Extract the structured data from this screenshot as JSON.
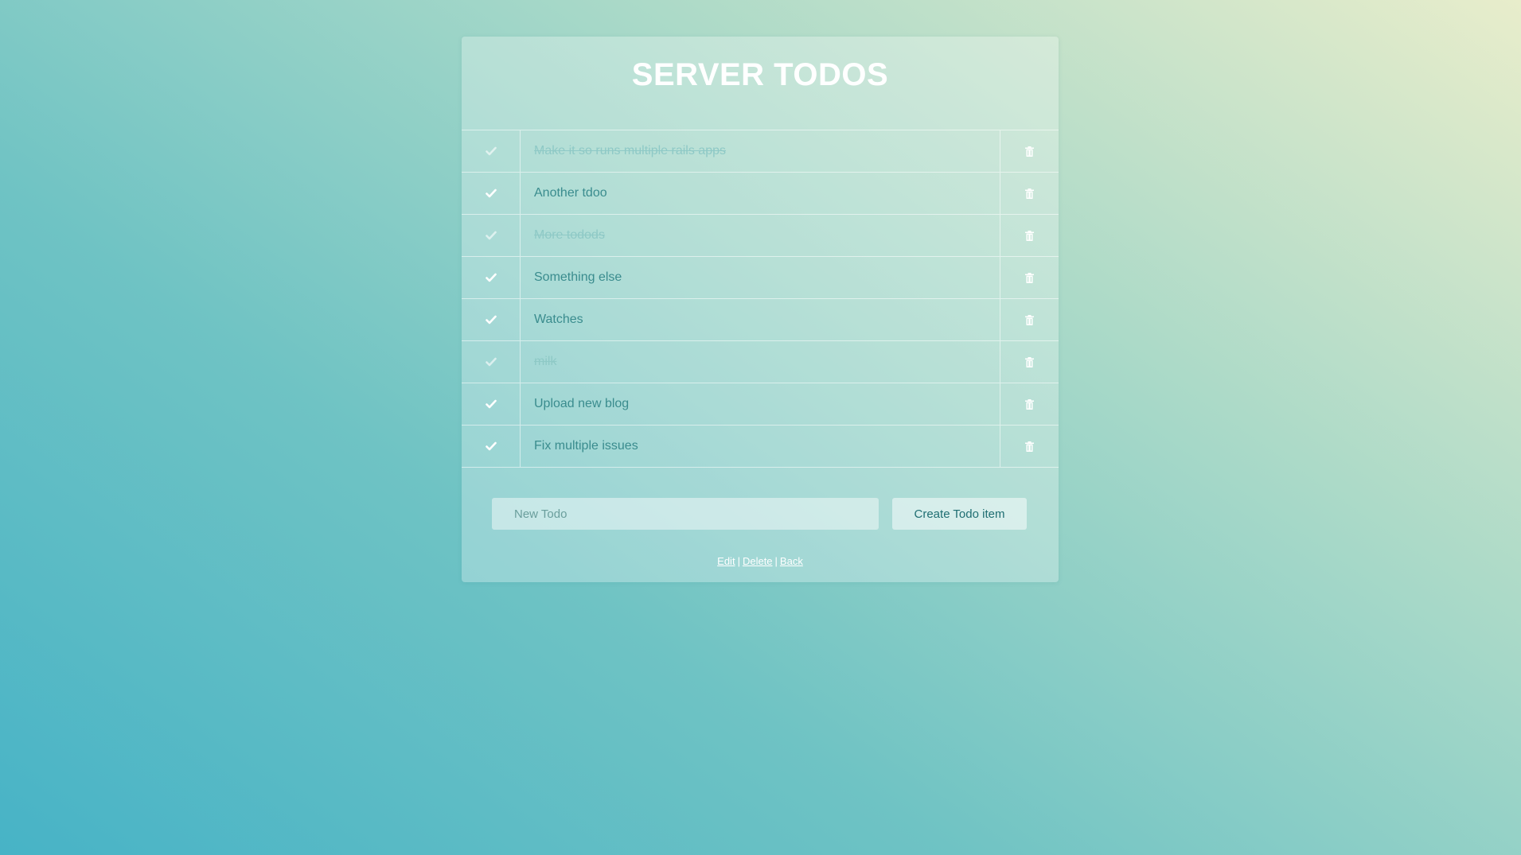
{
  "header": {
    "title": "SERVER TODOS"
  },
  "todos": [
    {
      "text": "Make it so runs multiple rails apps",
      "done": true
    },
    {
      "text": "Another tdoo",
      "done": false
    },
    {
      "text": "More todods",
      "done": true
    },
    {
      "text": "Something else",
      "done": false
    },
    {
      "text": "Watches",
      "done": false
    },
    {
      "text": "milk",
      "done": true
    },
    {
      "text": "Upload new blog",
      "done": false
    },
    {
      "text": "Fix multiple issues",
      "done": false
    }
  ],
  "icons": {
    "check": "check-icon",
    "delete": "trash-icon"
  },
  "form": {
    "placeholder": "New Todo",
    "value": "",
    "submit_label": "Create Todo item"
  },
  "links": {
    "edit": "Edit",
    "delete": "Delete",
    "back": "Back",
    "separator": "|"
  },
  "colors": {
    "text": "#3a8c8e",
    "done_text": "#8ec9c6",
    "button_text": "#1f6e72",
    "title": "#ffffff"
  }
}
